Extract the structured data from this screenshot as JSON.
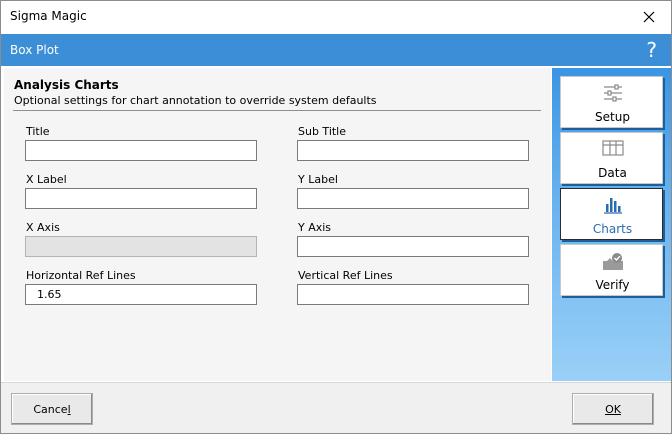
{
  "window": {
    "title": "Sigma Magic"
  },
  "header": {
    "title": "Box Plot",
    "help_label": "?"
  },
  "section": {
    "title": "Analysis Charts",
    "subtitle": "Optional settings for chart annotation to override system defaults"
  },
  "fields": {
    "title": {
      "label": "Title",
      "value": ""
    },
    "sub_title": {
      "label": "Sub Title",
      "value": ""
    },
    "x_label": {
      "label": "X Label",
      "value": ""
    },
    "y_label": {
      "label": "Y Label",
      "value": ""
    },
    "x_axis": {
      "label": "X Axis",
      "value": ""
    },
    "y_axis": {
      "label": "Y Axis",
      "value": ""
    },
    "h_ref_lines": {
      "label": "Horizontal Ref Lines",
      "value": "1.65"
    },
    "v_ref_lines": {
      "label": "Vertical Ref Lines",
      "value": ""
    }
  },
  "sidebar": {
    "items": [
      {
        "label": "Setup",
        "icon": "sliders-icon"
      },
      {
        "label": "Data",
        "icon": "table-icon"
      },
      {
        "label": "Charts",
        "icon": "bar-chart-icon",
        "active": true
      },
      {
        "label": "Verify",
        "icon": "verify-icon"
      }
    ]
  },
  "footer": {
    "cancel_label": "Cance",
    "cancel_mnemonic": "l",
    "ok_label": "",
    "ok_mnemonic": "OK"
  },
  "colors": {
    "header_bg": "#3c8fd6",
    "sidebar_top": "#3b95e3",
    "sidebar_bottom": "#9ad0f7",
    "active_label": "#2a6bb0"
  }
}
